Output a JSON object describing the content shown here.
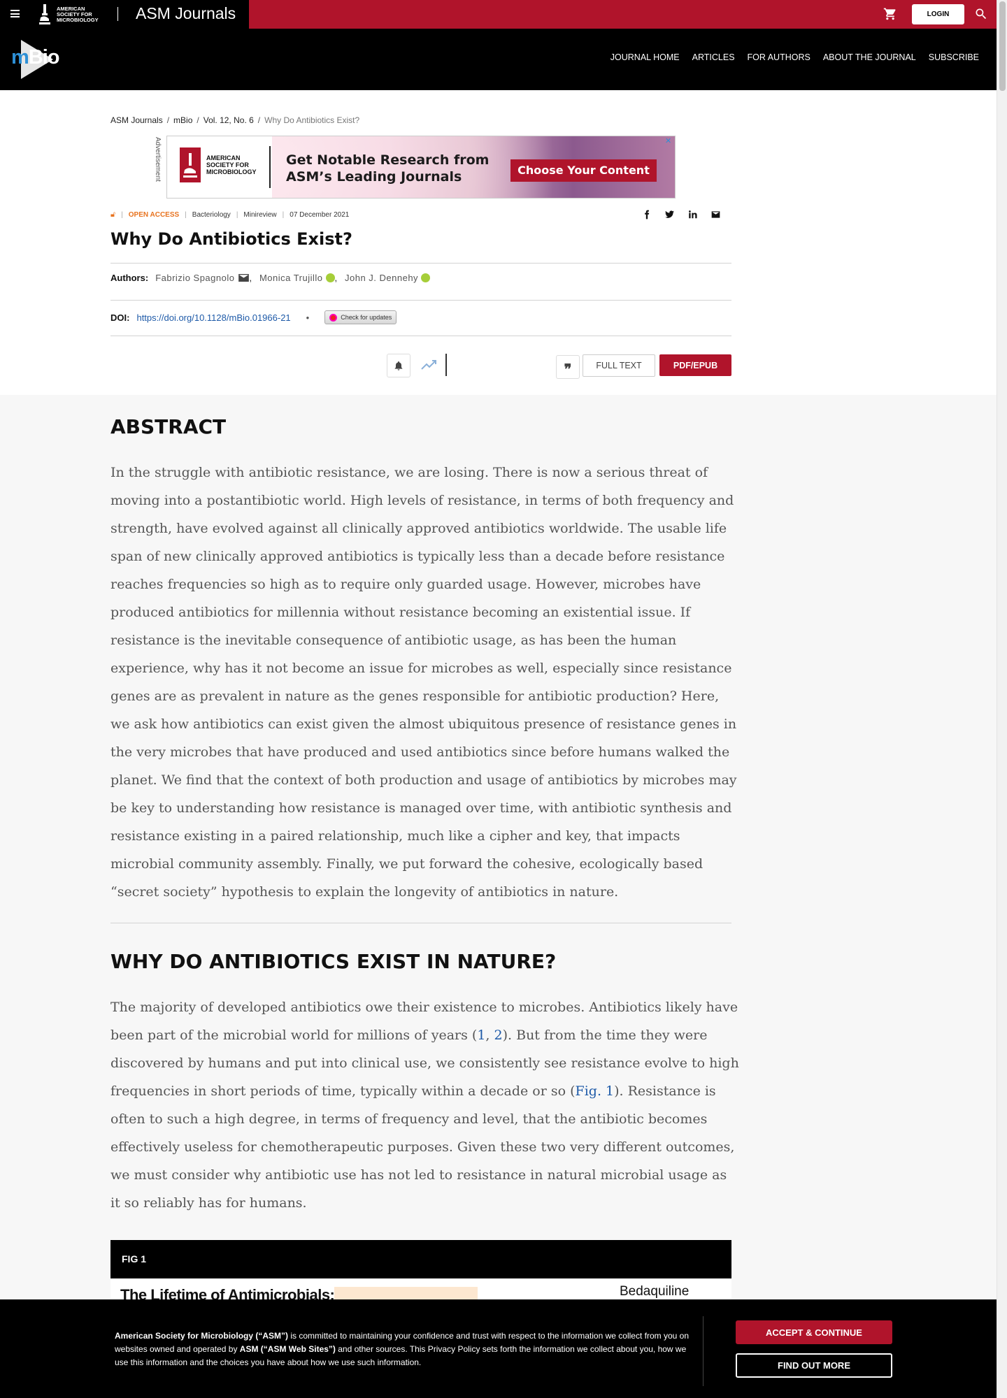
{
  "topbar": {
    "org_logo_text": [
      "AMERICAN",
      "SOCIETY FOR",
      "MICROBIOLOGY"
    ],
    "brand": "ASM Journals",
    "login_label": "LOGIN"
  },
  "journal": {
    "logo_m": "m",
    "logo_bio": "Bio",
    "nav": [
      "JOURNAL HOME",
      "ARTICLES",
      "FOR AUTHORS",
      "ABOUT THE JOURNAL",
      "SUBSCRIBE"
    ]
  },
  "breadcrumb": [
    "ASM Journals",
    "mBio",
    "Vol. 12, No. 6",
    "Why Do Antibiotics Exist?"
  ],
  "ad": {
    "side_label": "Advertisement",
    "logo_text": [
      "AMERICAN",
      "SOCIETY FOR",
      "MICROBIOLOGY"
    ],
    "headline_1": "Get Notable Research from",
    "headline_2": "ASM’s Leading Journals",
    "cta": "Choose Your Content"
  },
  "meta": {
    "access": "OPEN ACCESS",
    "category": "Bacteriology",
    "type": "Minireview",
    "date": "07 December 2021"
  },
  "article": {
    "title": "Why Do Antibiotics Exist?",
    "authors_label": "Authors",
    "authors": [
      "Fabrizio Spagnolo",
      "Monica Trujillo",
      "John J. Dennehy"
    ],
    "doi_label": "DOI",
    "doi": "https://doi.org/10.1128/mBio.01966-21",
    "check_updates": "Check for updates",
    "full_text_label": "FULL TEXT",
    "pdf_label": "PDF/EPUB"
  },
  "abstract": {
    "heading": "ABSTRACT",
    "text": "In the struggle with antibiotic resistance, we are losing. There is now a serious threat of moving into a postantibiotic world. High levels of resistance, in terms of both frequency and strength, have evolved against all clinically approved antibiotics worldwide. The usable life span of new clinically approved antibiotics is typically less than a decade before resistance reaches frequencies so high as to require only guarded usage. However, microbes have produced antibiotics for millennia without resistance becoming an existential issue. If resistance is the inevitable consequence of antibiotic usage, as has been the human experience, why has it not become an issue for microbes as well, especially since resistance genes are as prevalent in nature as the genes responsible for antibiotic production? Here, we ask how antibiotics can exist given the almost ubiquitous presence of resistance genes in the very microbes that have produced and used antibiotics since before humans walked the planet. We find that the context of both production and usage of antibiotics by microbes may be key to understanding how resistance is managed over time, with antibiotic synthesis and resistance existing in a paired relationship, much like a cipher and key, that impacts microbial community assembly. Finally, we put forward the cohesive, ecologically based “secret society” hypothesis to explain the longevity of antibiotics in nature."
  },
  "section1": {
    "heading": "WHY DO ANTIBIOTICS EXIST IN NATURE?",
    "p1_a": "The majority of developed antibiotics owe their existence to microbes. Antibiotics likely have been part of the microbial world for millions of years (",
    "ref1": "1",
    "p1_b": ", ",
    "ref2": "2",
    "p1_c": "). But from the time they were discovered by humans and put into clinical use, we consistently see resistance evolve to high frequencies in short periods of time, typically within a decade or so (",
    "fig_ref": "Fig. 1",
    "p1_d": "). Resistance is often to such a high degree, in terms of frequency and level, that the antibiotic becomes effectively useless for chemotherapeutic purposes. Given these two very different outcomes, we must consider why antibiotic use has not led to resistance in natural microbial usage as it so reliably has for humans."
  },
  "figure": {
    "label": "FIG 1",
    "image_title": "The Lifetime of Antimicrobials:",
    "image_label_right": "Bedaquiline"
  },
  "cookie": {
    "org": "American Society for Microbiology (“ASM”)",
    "text_a": " is committed to maintaining your confidence and trust with respect to the information we collect from you on websites owned and operated by ",
    "sites": "ASM (“ASM Web Sites”)",
    "text_b": " and other sources. This Privacy Policy sets forth the information we collect about you, how we use this information and the choices you have about how we use such information.",
    "accept": "ACCEPT & CONTINUE",
    "find_out": "FIND OUT MORE"
  },
  "colors": {
    "brand_red": "#b0142b",
    "link_blue": "#1e5aa8",
    "open_access_orange": "#e8731f",
    "orcid_green": "#a6ce39"
  }
}
